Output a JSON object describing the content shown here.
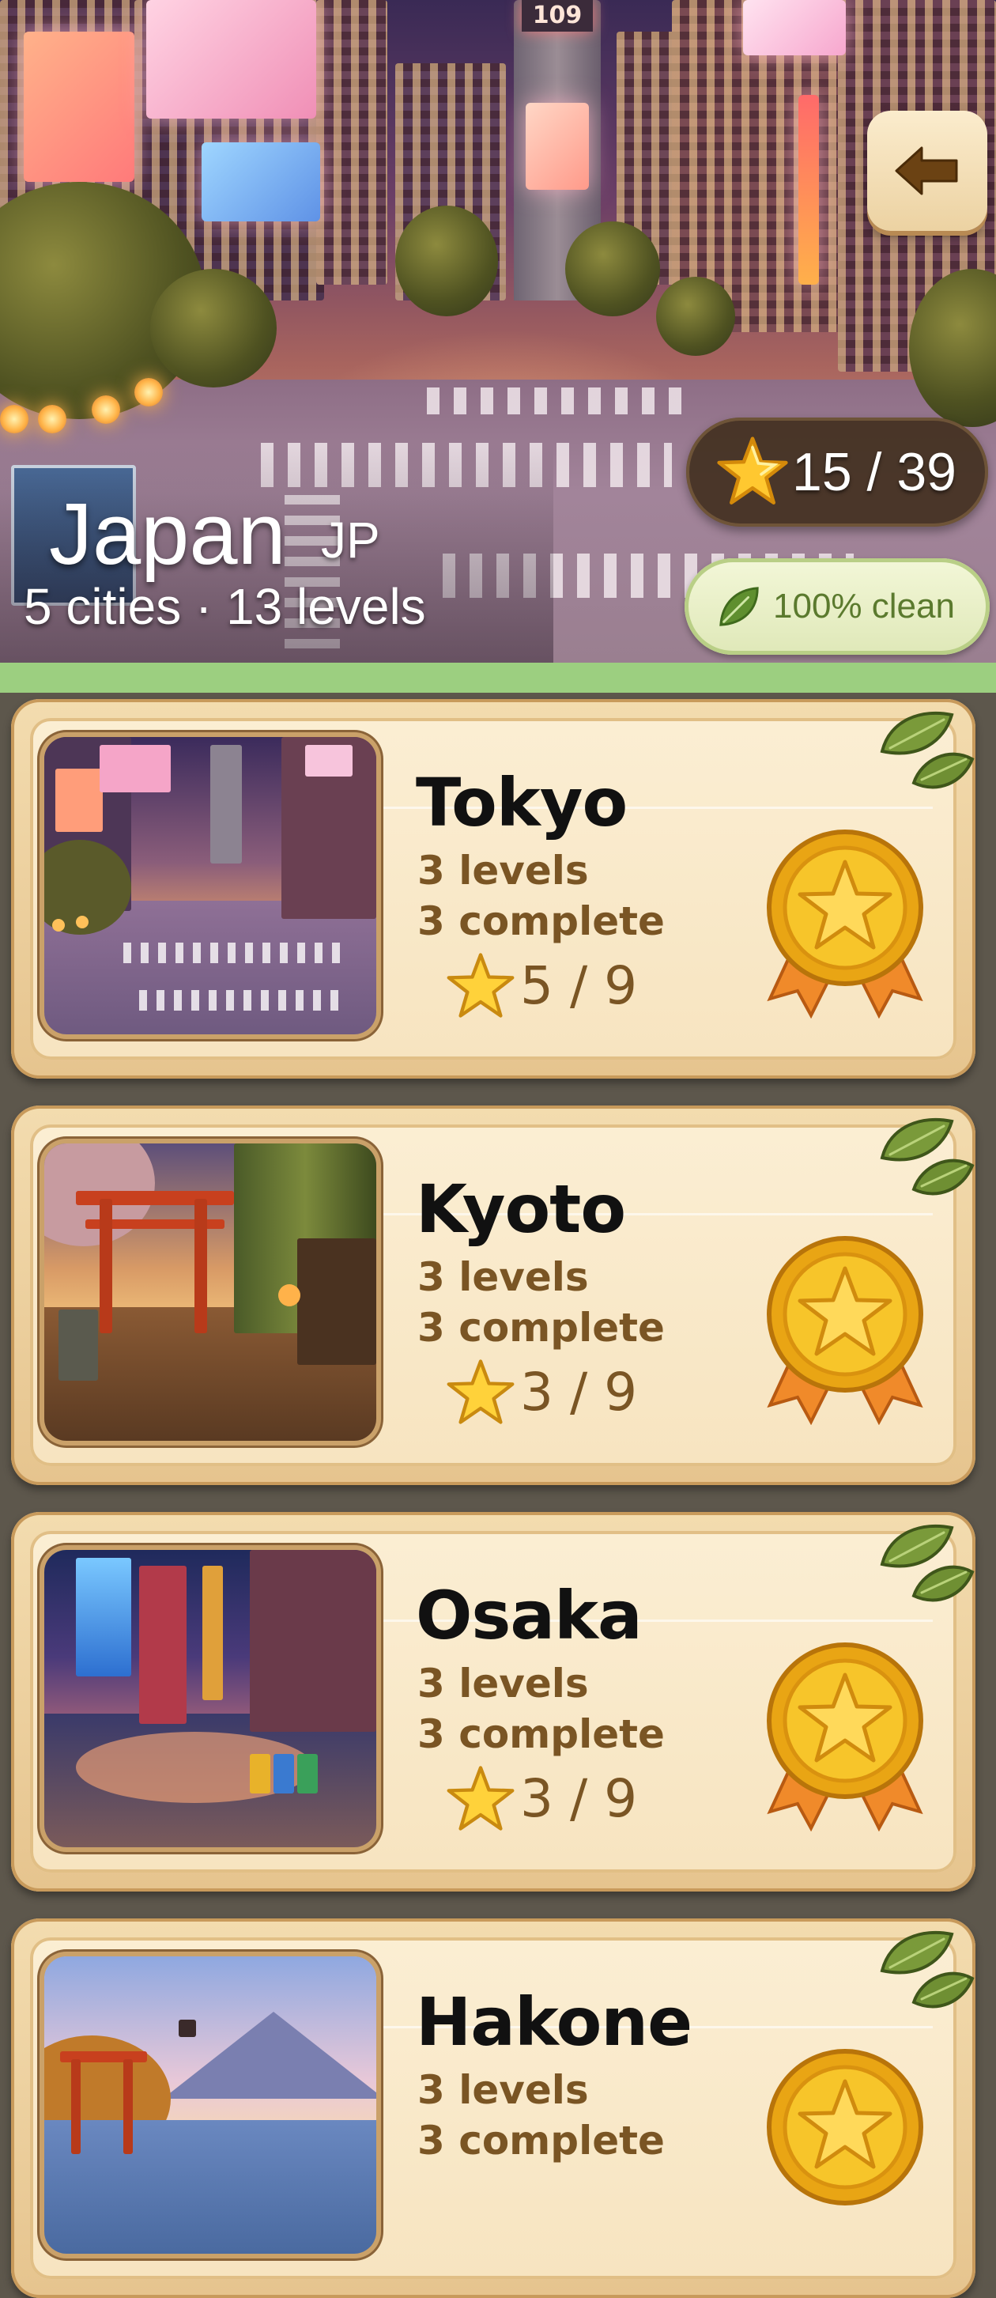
{
  "header": {
    "country_name": "Japan",
    "country_code": "JP",
    "subtitle": "5 cities · 13 levels",
    "stars_total": "15 / 39",
    "clean_label": "100% clean",
    "billboard_number": "109",
    "back_icon": "arrow-left-icon",
    "star_icon": "star-icon",
    "leaf_icon": "leaf-icon"
  },
  "colors": {
    "accent_green": "#9ccf80",
    "card_bg": "#fbeed3",
    "text_brown": "#7a5524",
    "medal_gold": "#f2b81d"
  },
  "cities": [
    {
      "name": "Tokyo",
      "levels": "3 levels",
      "complete": "3 complete",
      "stars": "5 / 9"
    },
    {
      "name": "Kyoto",
      "levels": "3 levels",
      "complete": "3 complete",
      "stars": "3 / 9"
    },
    {
      "name": "Osaka",
      "levels": "3 levels",
      "complete": "3 complete",
      "stars": "3 / 9"
    },
    {
      "name": "Hakone",
      "levels": "3 levels",
      "complete": "3 complete",
      "stars": ""
    }
  ]
}
